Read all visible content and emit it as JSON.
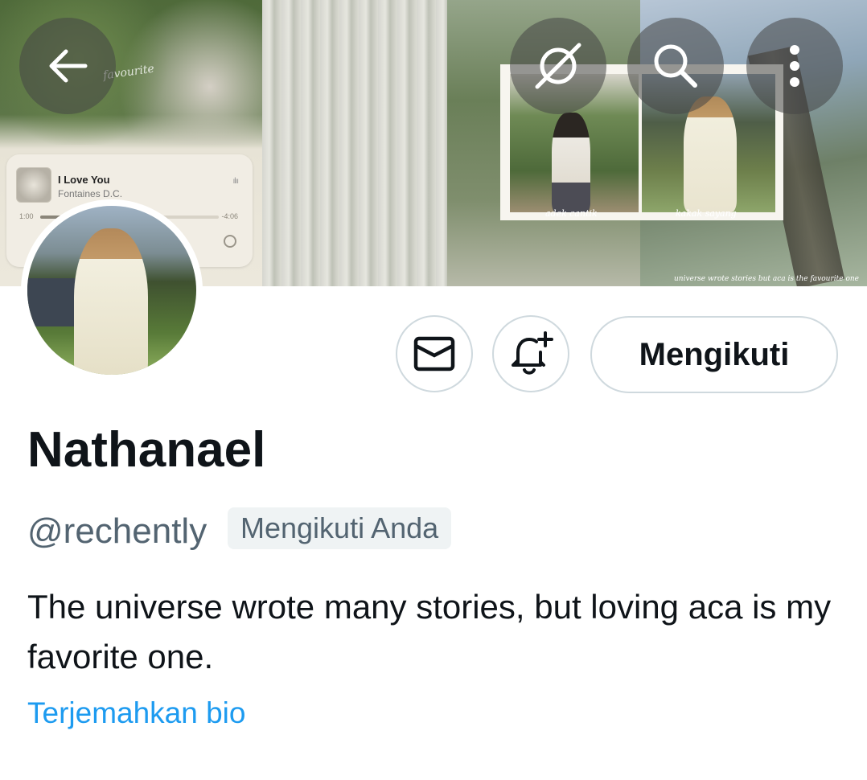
{
  "banner": {
    "music_widget": {
      "song_title": "I Love You",
      "artist": "Fontaines D.C.",
      "time_elapsed": "1:00",
      "time_remaining": "-4:06",
      "progress": 0.2
    },
    "watermark": "favourite",
    "collage_captions": [
      "adek cantik",
      "kakak sayang"
    ],
    "quote": "universe wrote stories but aca is the favourite one"
  },
  "header_buttons": {
    "back_icon": "arrow-left-icon",
    "grok_icon": "grok-icon",
    "search_icon": "search-icon",
    "more_icon": "more-vertical-icon"
  },
  "actions": {
    "message_icon": "envelope-icon",
    "notify_icon": "bell-plus-icon",
    "follow_label": "Mengikuti"
  },
  "profile": {
    "name": "Nathanael",
    "handle": "@rechently",
    "follows_you_badge": "Mengikuti Anda",
    "bio": "The universe wrote many stories, but loving aca is my favorite one.",
    "translate_link": "Terjemahkan bio"
  },
  "colors": {
    "text_primary": "#0f1419",
    "text_secondary": "#536471",
    "link": "#1d9bf0",
    "border": "#cfd9de",
    "badge_bg": "#eff3f4"
  }
}
